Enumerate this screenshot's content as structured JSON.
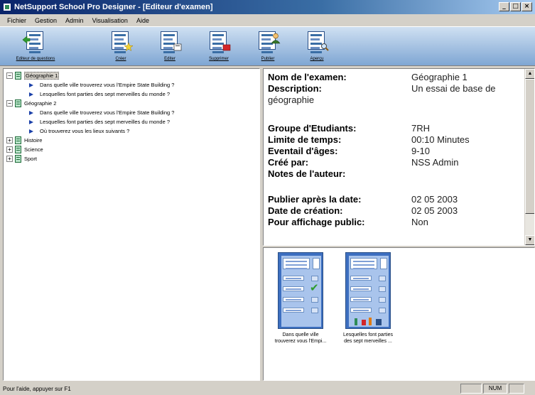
{
  "window": {
    "title": "NetSupport School Pro Designer - [Editeur d'examen]"
  },
  "window_controls": {
    "minimize": "_",
    "restore": "□",
    "close": "×"
  },
  "menubar": {
    "items": [
      "Fichier",
      "Gestion",
      "Admin",
      "Visualisation",
      "Aide"
    ]
  },
  "toolbar": {
    "items": [
      {
        "label": "Editeur de questions",
        "icon": "question-editor-icon"
      },
      {
        "label": "Créer",
        "icon": "create-test-icon"
      },
      {
        "label": "Editer",
        "icon": "edit-test-icon"
      },
      {
        "label": "Supprimer",
        "icon": "delete-test-icon"
      },
      {
        "label": "Publier",
        "icon": "publish-icon"
      },
      {
        "label": "Aperçu",
        "icon": "preview-icon"
      }
    ]
  },
  "tree": {
    "exams": [
      {
        "name": "Géographie 1",
        "expander": "−",
        "selected": true,
        "questions": [
          "Dans quelle ville trouverez vous l'Empire State Building ?",
          "Lesquelles font parties des sept merveilles du monde ?"
        ]
      },
      {
        "name": "Géographie 2",
        "expander": "−",
        "questions": [
          "Dans quelle ville trouverez vous l'Empire State Building ?",
          "Lesquelles font parties des sept merveilles du monde ?",
          "Où trouverez vous les lieux suivants ?"
        ]
      },
      {
        "name": "Histoire",
        "expander": "+",
        "questions": []
      },
      {
        "name": "Science",
        "expander": "+",
        "questions": []
      },
      {
        "name": "Sport",
        "expander": "+",
        "questions": []
      }
    ]
  },
  "details": {
    "exam_name_label": "Nom de l'examen:",
    "exam_name": "Géographie 1",
    "description_label": "Description:",
    "description_line1": "Un essai de base de",
    "description_line2": "géographie",
    "group_label": "Groupe d'Etudiants:",
    "group": "7RH",
    "time_label": "Limite de temps:",
    "time": "00:10 Minutes",
    "age_label": "Eventail d'âges:",
    "age": "9-10",
    "author_label": "Créé par:",
    "author": "NSS Admin",
    "notes_label": "Notes de l'auteur:",
    "publish_label": "Publier après la date:",
    "publish_date": "02 05 2003",
    "created_label": "Date de création:",
    "created_date": "02 05 2003",
    "public_label": "Pour affichage public:",
    "public": "Non"
  },
  "scrollbar": {
    "up": "▲",
    "down": "▼"
  },
  "thumbnails": [
    {
      "caption1": "Dans quelle ville",
      "caption2": "trouverez vous l'Empi..."
    },
    {
      "caption1": "Lesquelles font parties",
      "caption2": "des sept merveilles ..."
    }
  ],
  "statusbar": {
    "text": "Pour l'aide, appuyer sur F1",
    "num": "NUM"
  }
}
